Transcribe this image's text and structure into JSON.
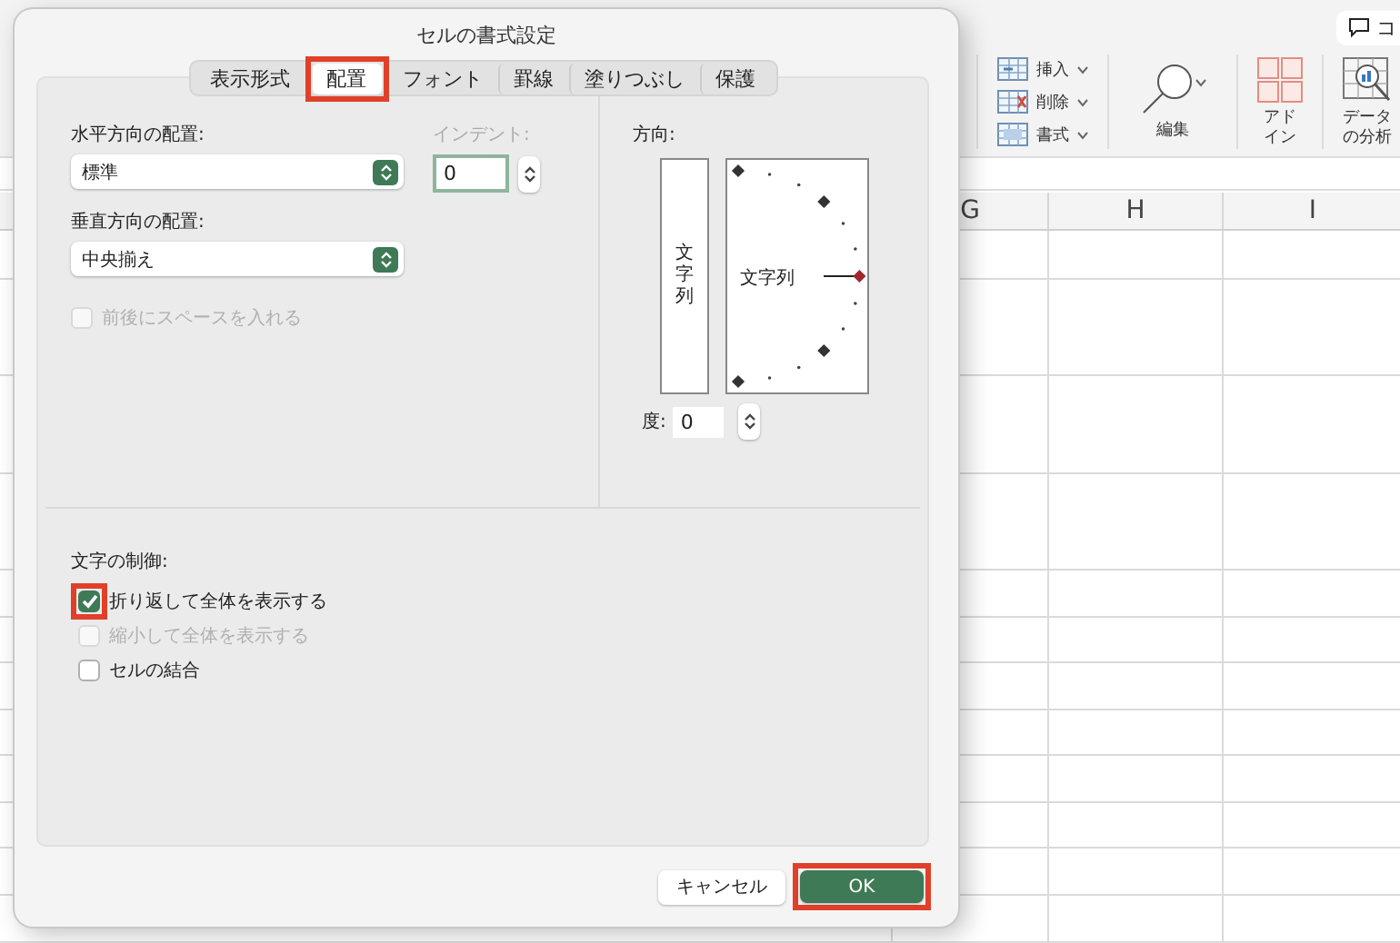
{
  "ribbon": {
    "comment_button": "コ",
    "cell_commands": [
      {
        "label": "挿入",
        "kind": "insert"
      },
      {
        "label": "削除",
        "kind": "delete"
      },
      {
        "label": "書式",
        "kind": "format"
      }
    ],
    "edit": "編集",
    "addins": [
      "アド",
      "イン"
    ],
    "data_analysis": [
      "データ",
      "の分析"
    ]
  },
  "sheet": {
    "columns": [
      "G",
      "H",
      "I"
    ]
  },
  "dialog": {
    "title": "セルの書式設定",
    "tabs": [
      {
        "label": "表示形式",
        "selected": false,
        "highlighted": false
      },
      {
        "label": "配置",
        "selected": true,
        "highlighted": true
      },
      {
        "label": "フォント",
        "selected": false,
        "highlighted": false
      },
      {
        "label": "罫線",
        "selected": false,
        "highlighted": false
      },
      {
        "label": "塗りつぶし",
        "selected": false,
        "highlighted": false
      },
      {
        "label": "保護",
        "selected": false,
        "highlighted": false
      }
    ],
    "horizontal_alignment": {
      "label": "水平方向の配置:",
      "value": "標準"
    },
    "indent": {
      "label": "インデント:",
      "value": "0",
      "disabled": true
    },
    "vertical_alignment": {
      "label": "垂直方向の配置:",
      "value": "中央揃え"
    },
    "distributed": {
      "label": "前後にスペースを入れる",
      "checked": false,
      "disabled": true
    },
    "orientation": {
      "label": "方向:",
      "vertical_text": "文字列",
      "text": "文字列",
      "degrees_label": "度:",
      "degrees": "0"
    },
    "text_control": {
      "label": "文字の制御:",
      "options": [
        {
          "label": "折り返して全体を表示する",
          "checked": true,
          "disabled": false,
          "highlighted": true
        },
        {
          "label": "縮小して全体を表示する",
          "checked": false,
          "disabled": true,
          "highlighted": false
        },
        {
          "label": "セルの結合",
          "checked": false,
          "disabled": false,
          "highlighted": false
        }
      ]
    },
    "buttons": [
      {
        "label": "キャンセル",
        "kind": "secondary",
        "highlighted": false
      },
      {
        "label": "OK",
        "kind": "primary",
        "highlighted": true
      }
    ]
  }
}
